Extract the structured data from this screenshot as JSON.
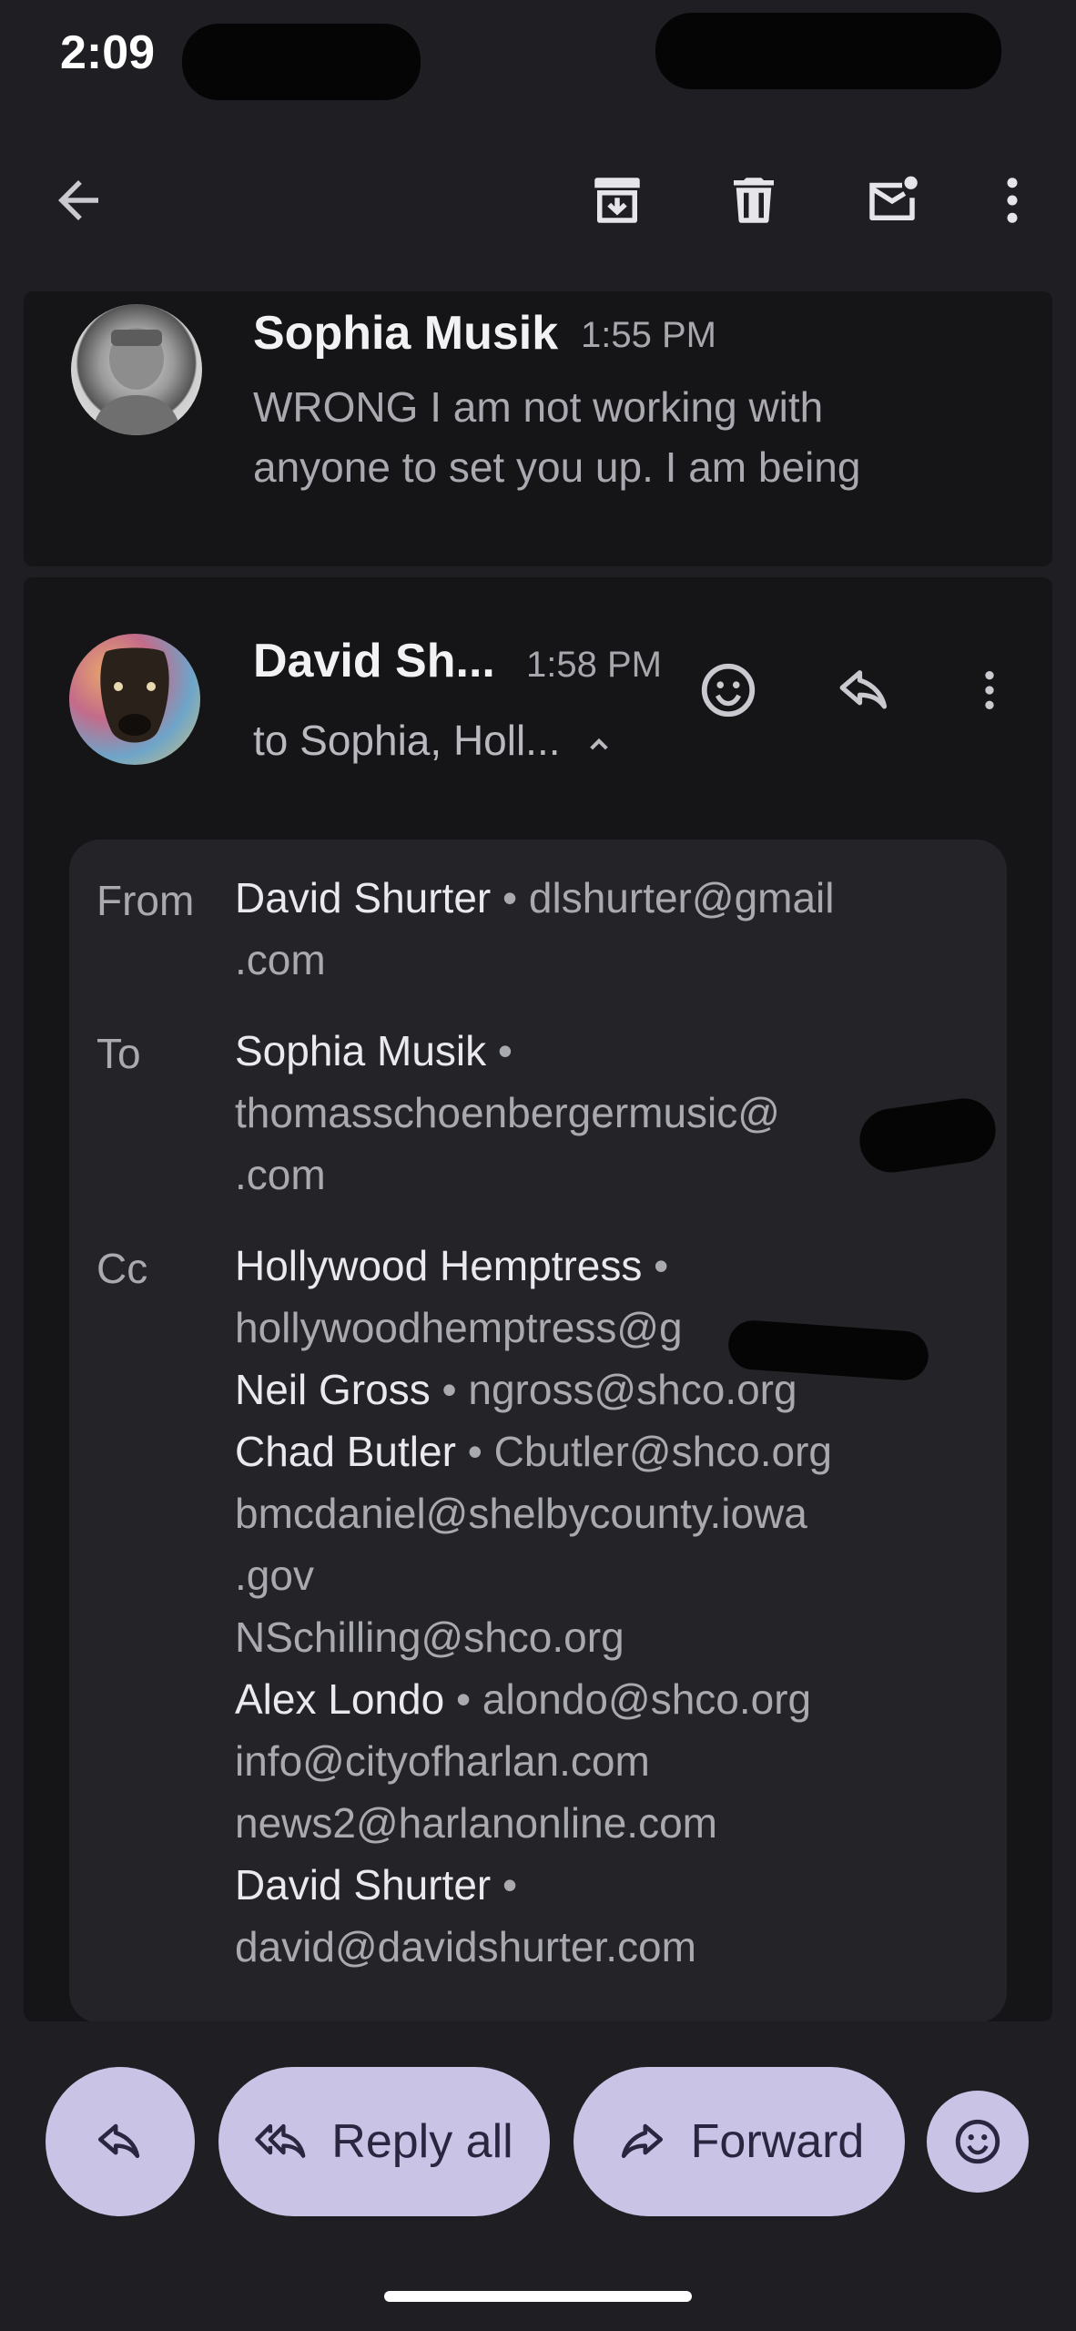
{
  "status_bar": {
    "time": "2:09"
  },
  "toolbar": {
    "back_icon": "arrow-back-icon",
    "archive_icon": "archive-icon",
    "delete_icon": "trash-icon",
    "mark_unread_icon": "mark-unread-icon",
    "more_icon": "more-vert-icon"
  },
  "messages": [
    {
      "sender": "Sophia Musik",
      "time": "1:55 PM",
      "snippet_line1": "WRONG I am not working with",
      "snippet_line2": "anyone to set you up. I am being"
    },
    {
      "sender": "David Sh...",
      "time": "1:58 PM",
      "recipients": "to Sophia, Holl...",
      "details": {
        "from_label": "From",
        "from_name": "David Shurter",
        "from_email_l1": "dlshurter@gmail",
        "from_email_l2": ".com",
        "to_label": "To",
        "to_name": "Sophia Musik",
        "to_email_l1": "thomasschoenbergermusic@",
        "to_email_l2": ".com",
        "cc_label": "Cc",
        "cc": [
          {
            "name": "Hollywood Hemptress",
            "email": "hollywoodhemptress@g"
          },
          {
            "name": "Neil Gross",
            "email": "ngross@shco.org"
          },
          {
            "name": "Chad Butler",
            "email": "Cbutler@shco.org"
          },
          {
            "email_l1": "bmcdaniel@shelbycounty.iowa",
            "email_l2": ".gov"
          },
          {
            "email": "NSchilling@shco.org"
          },
          {
            "name": "Alex Londo",
            "email": "alondo@shco.org"
          },
          {
            "email": "info@cityofharlan.com"
          },
          {
            "email": "news2@harlanonline.com"
          },
          {
            "name": "David Shurter",
            "email": "david@davidshurter.com"
          }
        ]
      }
    }
  ],
  "actions": {
    "reply_all": "Reply all",
    "forward": "Forward"
  },
  "colors": {
    "background": "#1f1f23",
    "card": "#151518",
    "pill": "#c9c3e6"
  }
}
